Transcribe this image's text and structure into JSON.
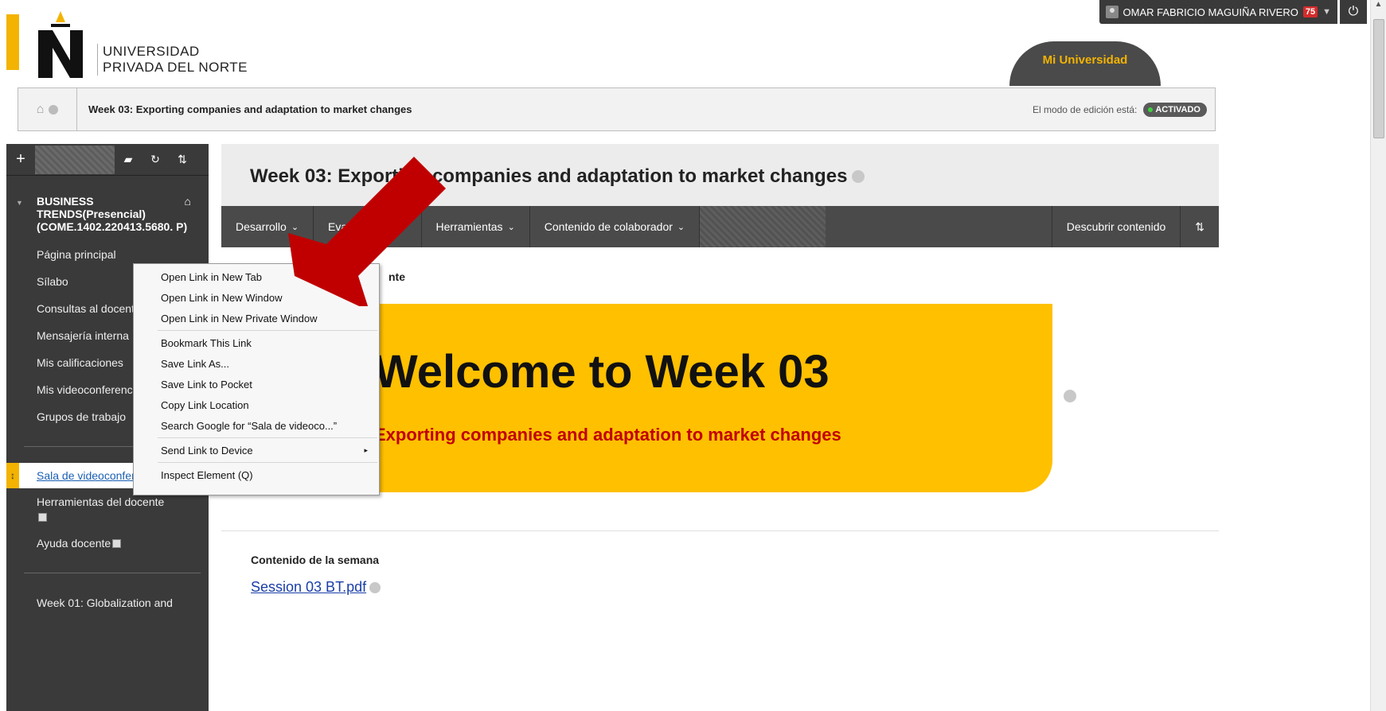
{
  "user": {
    "name": "OMAR FABRICIO MAGUIÑA RIVERO",
    "notifications": "75",
    "caret": "▼",
    "logout_icon": "⏻"
  },
  "brand": {
    "line1": "UNIVERSIDAD",
    "line2": "PRIVADA DEL NORTE",
    "mi_universidad": "Mi Universidad",
    "accent": "#f3b300"
  },
  "breadcrumb": {
    "home_icon": "⌂",
    "text": "Week 03: Exporting companies and adaptation to market changes",
    "edit_mode_label": "El modo de edición está:",
    "edit_mode_value": "ACTIVADO"
  },
  "sidebar": {
    "tool_plus": "+",
    "tool_folder": "▰",
    "tool_refresh": "↻",
    "tool_sort": "⇅",
    "course_title": "BUSINESS TRENDS(Presencial) (COME.1402.220413.5680. P)",
    "items": [
      "Página principal",
      "Sílabo",
      "Consultas al docente",
      "Mensajería interna",
      "Mis calificaciones",
      "Mis videoconferencias",
      "Grupos de trabajo"
    ],
    "active_item": "Sala de videoconferencias",
    "active_grip": "↕",
    "after_items": [
      "Herramientas del docente",
      "Ayuda docente"
    ],
    "bottom_item": "Week 01: Globalization and"
  },
  "page": {
    "title": "Week 03: Exporting companies and adaptation to market changes",
    "nav": [
      {
        "label": "Desarrollo",
        "chevron": "⌄"
      },
      {
        "label": "Evaluaciones",
        "chevron": "⌄"
      },
      {
        "label": "Herramientas",
        "chevron": "⌄"
      },
      {
        "label": "Contenido de colaborador",
        "chevron": "⌄"
      }
    ],
    "nav_discover": "Descubrir contenido",
    "nav_sort": "⇅",
    "subheading_fragment": "nte",
    "banner_title": "Welcome to Week 03",
    "banner_subtitle": "Exporting companies and adaptation to market changes",
    "section_title": "Contenido de la semana",
    "file_link": "Session 03 BT.pdf"
  },
  "context_menu": {
    "items": [
      "Open Link in New Tab",
      "Open Link in New Window",
      "Open Link in New Private Window",
      "Bookmark This Link",
      "Save Link As...",
      "Save Link to Pocket",
      "Copy Link Location",
      "Search Google for “Sala de videoco...”",
      "Send Link to Device",
      "Inspect Element (Q)"
    ],
    "submenu_arrow": "▸"
  }
}
